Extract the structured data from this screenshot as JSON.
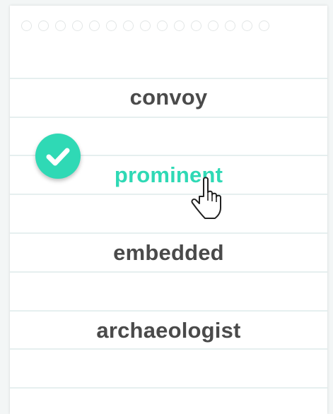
{
  "words": [
    {
      "text": "convoy",
      "selected": false
    },
    {
      "text": "prominent",
      "selected": true
    },
    {
      "text": "embedded",
      "selected": false
    },
    {
      "text": "archaeologist",
      "selected": false
    }
  ],
  "colors": {
    "accent": "#2fd9b5",
    "text": "#4a4a4a",
    "rule": "#e6efef"
  },
  "icons": {
    "check": "checkmark-circle-icon",
    "cursor": "hand-pointer-icon"
  }
}
